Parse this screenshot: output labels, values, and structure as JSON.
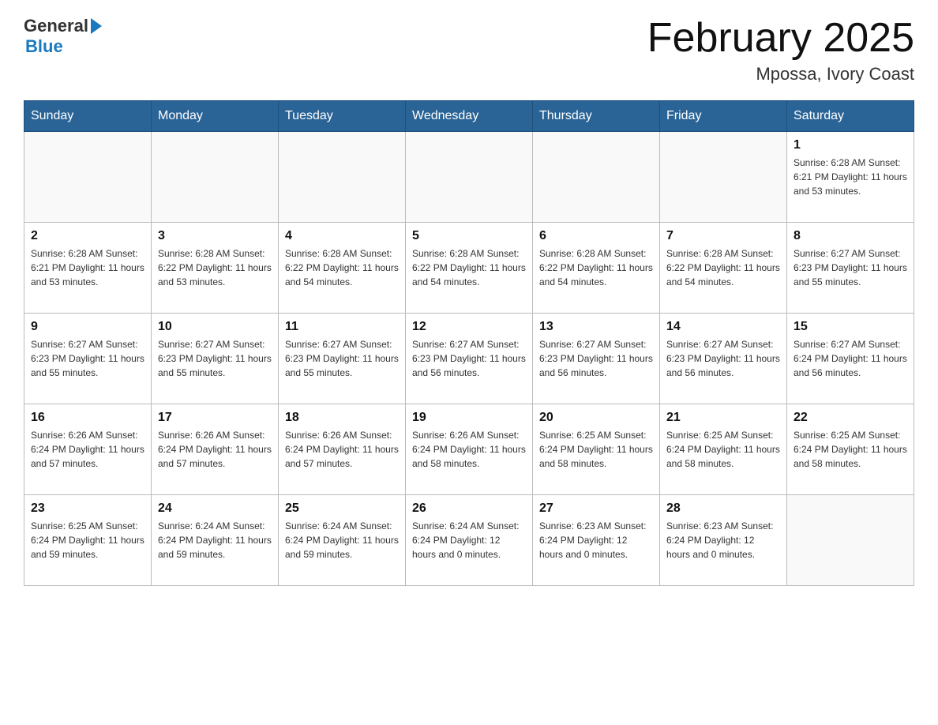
{
  "header": {
    "logo_general": "General",
    "logo_blue": "Blue",
    "month_title": "February 2025",
    "location": "Mpossa, Ivory Coast"
  },
  "days_of_week": [
    "Sunday",
    "Monday",
    "Tuesday",
    "Wednesday",
    "Thursday",
    "Friday",
    "Saturday"
  ],
  "weeks": [
    [
      {
        "day": "",
        "info": ""
      },
      {
        "day": "",
        "info": ""
      },
      {
        "day": "",
        "info": ""
      },
      {
        "day": "",
        "info": ""
      },
      {
        "day": "",
        "info": ""
      },
      {
        "day": "",
        "info": ""
      },
      {
        "day": "1",
        "info": "Sunrise: 6:28 AM\nSunset: 6:21 PM\nDaylight: 11 hours\nand 53 minutes."
      }
    ],
    [
      {
        "day": "2",
        "info": "Sunrise: 6:28 AM\nSunset: 6:21 PM\nDaylight: 11 hours\nand 53 minutes."
      },
      {
        "day": "3",
        "info": "Sunrise: 6:28 AM\nSunset: 6:22 PM\nDaylight: 11 hours\nand 53 minutes."
      },
      {
        "day": "4",
        "info": "Sunrise: 6:28 AM\nSunset: 6:22 PM\nDaylight: 11 hours\nand 54 minutes."
      },
      {
        "day": "5",
        "info": "Sunrise: 6:28 AM\nSunset: 6:22 PM\nDaylight: 11 hours\nand 54 minutes."
      },
      {
        "day": "6",
        "info": "Sunrise: 6:28 AM\nSunset: 6:22 PM\nDaylight: 11 hours\nand 54 minutes."
      },
      {
        "day": "7",
        "info": "Sunrise: 6:28 AM\nSunset: 6:22 PM\nDaylight: 11 hours\nand 54 minutes."
      },
      {
        "day": "8",
        "info": "Sunrise: 6:27 AM\nSunset: 6:23 PM\nDaylight: 11 hours\nand 55 minutes."
      }
    ],
    [
      {
        "day": "9",
        "info": "Sunrise: 6:27 AM\nSunset: 6:23 PM\nDaylight: 11 hours\nand 55 minutes."
      },
      {
        "day": "10",
        "info": "Sunrise: 6:27 AM\nSunset: 6:23 PM\nDaylight: 11 hours\nand 55 minutes."
      },
      {
        "day": "11",
        "info": "Sunrise: 6:27 AM\nSunset: 6:23 PM\nDaylight: 11 hours\nand 55 minutes."
      },
      {
        "day": "12",
        "info": "Sunrise: 6:27 AM\nSunset: 6:23 PM\nDaylight: 11 hours\nand 56 minutes."
      },
      {
        "day": "13",
        "info": "Sunrise: 6:27 AM\nSunset: 6:23 PM\nDaylight: 11 hours\nand 56 minutes."
      },
      {
        "day": "14",
        "info": "Sunrise: 6:27 AM\nSunset: 6:23 PM\nDaylight: 11 hours\nand 56 minutes."
      },
      {
        "day": "15",
        "info": "Sunrise: 6:27 AM\nSunset: 6:24 PM\nDaylight: 11 hours\nand 56 minutes."
      }
    ],
    [
      {
        "day": "16",
        "info": "Sunrise: 6:26 AM\nSunset: 6:24 PM\nDaylight: 11 hours\nand 57 minutes."
      },
      {
        "day": "17",
        "info": "Sunrise: 6:26 AM\nSunset: 6:24 PM\nDaylight: 11 hours\nand 57 minutes."
      },
      {
        "day": "18",
        "info": "Sunrise: 6:26 AM\nSunset: 6:24 PM\nDaylight: 11 hours\nand 57 minutes."
      },
      {
        "day": "19",
        "info": "Sunrise: 6:26 AM\nSunset: 6:24 PM\nDaylight: 11 hours\nand 58 minutes."
      },
      {
        "day": "20",
        "info": "Sunrise: 6:25 AM\nSunset: 6:24 PM\nDaylight: 11 hours\nand 58 minutes."
      },
      {
        "day": "21",
        "info": "Sunrise: 6:25 AM\nSunset: 6:24 PM\nDaylight: 11 hours\nand 58 minutes."
      },
      {
        "day": "22",
        "info": "Sunrise: 6:25 AM\nSunset: 6:24 PM\nDaylight: 11 hours\nand 58 minutes."
      }
    ],
    [
      {
        "day": "23",
        "info": "Sunrise: 6:25 AM\nSunset: 6:24 PM\nDaylight: 11 hours\nand 59 minutes."
      },
      {
        "day": "24",
        "info": "Sunrise: 6:24 AM\nSunset: 6:24 PM\nDaylight: 11 hours\nand 59 minutes."
      },
      {
        "day": "25",
        "info": "Sunrise: 6:24 AM\nSunset: 6:24 PM\nDaylight: 11 hours\nand 59 minutes."
      },
      {
        "day": "26",
        "info": "Sunrise: 6:24 AM\nSunset: 6:24 PM\nDaylight: 12 hours\nand 0 minutes."
      },
      {
        "day": "27",
        "info": "Sunrise: 6:23 AM\nSunset: 6:24 PM\nDaylight: 12 hours\nand 0 minutes."
      },
      {
        "day": "28",
        "info": "Sunrise: 6:23 AM\nSunset: 6:24 PM\nDaylight: 12 hours\nand 0 minutes."
      },
      {
        "day": "",
        "info": ""
      }
    ]
  ]
}
